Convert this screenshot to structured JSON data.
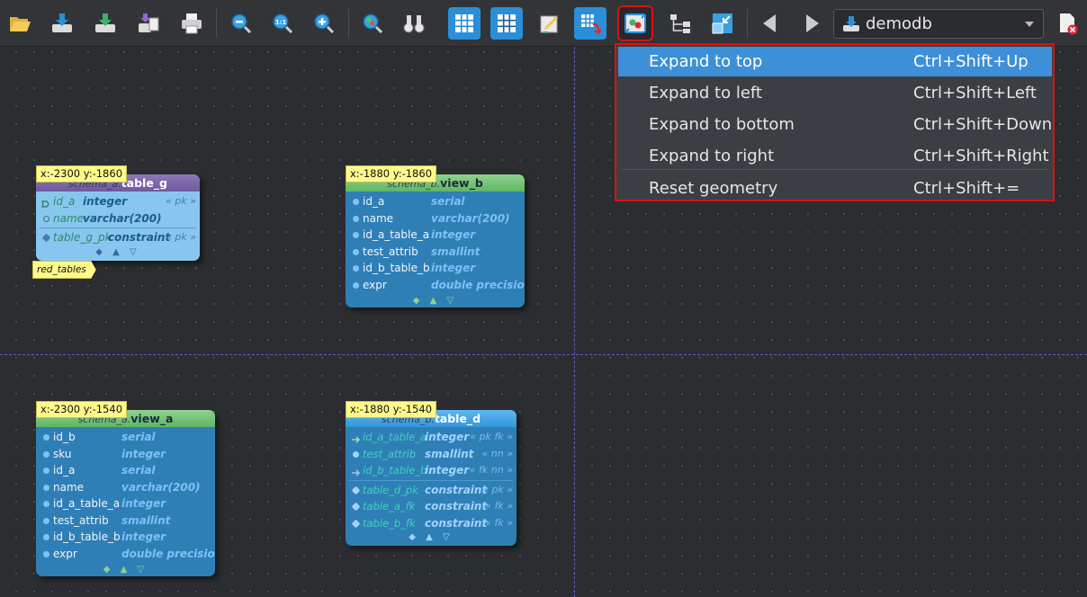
{
  "toolbar": {
    "buttons": [
      {
        "id": "open",
        "icon": "folder-open-icon"
      },
      {
        "id": "save",
        "icon": "save-icon"
      },
      {
        "id": "save-as",
        "icon": "save-as-icon"
      },
      {
        "id": "export",
        "icon": "export-icon"
      },
      {
        "id": "print",
        "icon": "printer-icon"
      },
      {
        "id": "zoom-out",
        "icon": "zoom-out-icon"
      },
      {
        "id": "zoom-reset",
        "icon": "zoom-reset-icon",
        "text": "1:1"
      },
      {
        "id": "zoom-in",
        "icon": "zoom-in-icon"
      },
      {
        "id": "overview",
        "icon": "overview-icon"
      },
      {
        "id": "find",
        "icon": "binoculars-icon"
      },
      {
        "id": "show-grid",
        "icon": "grid-icon"
      },
      {
        "id": "align-grid",
        "icon": "align-grid-icon"
      },
      {
        "id": "edit",
        "icon": "edit-icon"
      },
      {
        "id": "swap",
        "icon": "swap-objects-icon"
      },
      {
        "id": "expand-canvas",
        "icon": "expand-canvas-icon"
      },
      {
        "id": "arrange",
        "icon": "arrange-objects-icon"
      },
      {
        "id": "collapse",
        "icon": "collapse-icon"
      },
      {
        "id": "back",
        "icon": "arrow-left-icon"
      },
      {
        "id": "forward",
        "icon": "arrow-right-icon"
      }
    ],
    "database": "demodb"
  },
  "menu": {
    "items": [
      {
        "label": "Expand to top",
        "shortcut": "Ctrl+Shift+Up"
      },
      {
        "label": "Expand to left",
        "shortcut": "Ctrl+Shift+Left"
      },
      {
        "label": "Expand to bottom",
        "shortcut": "Ctrl+Shift+Down"
      },
      {
        "label": "Expand to right",
        "shortcut": "Ctrl+Shift+Right"
      },
      {
        "label": "Reset geometry",
        "shortcut": "Ctrl+Shift+="
      }
    ]
  },
  "canvas": {
    "table_g": {
      "coord": "x:-2300 y:-1860",
      "schema": "schema_a.",
      "name": "table_g",
      "tag": "red_tables",
      "columns": [
        {
          "name": "id_a",
          "type": "integer",
          "constraint": "« pk »"
        },
        {
          "name": "name",
          "type": "varchar(200)",
          "constraint": ""
        }
      ],
      "constraints": [
        {
          "name": "table_g_pk",
          "type": "constraint",
          "constraint": "« pk »"
        }
      ]
    },
    "view_b": {
      "coord": "x:-1880 y:-1860",
      "schema": "schema_b.",
      "name": "view_b",
      "columns": [
        {
          "name": "id_a",
          "type": "serial"
        },
        {
          "name": "name",
          "type": "varchar(200)"
        },
        {
          "name": "id_a_table_a",
          "type": "integer"
        },
        {
          "name": "test_attrib",
          "type": "smallint"
        },
        {
          "name": "id_b_table_b",
          "type": "integer"
        },
        {
          "name": "expr",
          "type": "double precision"
        }
      ]
    },
    "view_a": {
      "coord": "x:-2300 y:-1540",
      "schema": "schema_a.",
      "name": "view_a",
      "columns": [
        {
          "name": "id_b",
          "type": "serial"
        },
        {
          "name": "sku",
          "type": "integer"
        },
        {
          "name": "id_a",
          "type": "serial"
        },
        {
          "name": "name",
          "type": "varchar(200)"
        },
        {
          "name": "id_a_table_a",
          "type": "integer"
        },
        {
          "name": "test_attrib",
          "type": "smallint"
        },
        {
          "name": "id_b_table_b",
          "type": "integer"
        },
        {
          "name": "expr",
          "type": "double precision"
        }
      ]
    },
    "table_d": {
      "coord": "x:-1880 y:-1540",
      "schema": "schema_b.",
      "name": "table_d",
      "columns": [
        {
          "name": "id_a_table_a",
          "type": "integer",
          "constraint": "« pk fk »"
        },
        {
          "name": "test_attrib",
          "type": "smallint",
          "constraint": "« nn »"
        },
        {
          "name": "id_b_table_b",
          "type": "integer",
          "constraint": "« fk nn »"
        }
      ],
      "constraints": [
        {
          "name": "table_d_pk",
          "type": "constraint",
          "constraint": "« pk »"
        },
        {
          "name": "table_a_fk",
          "type": "constraint",
          "constraint": "« fk »"
        },
        {
          "name": "table_b_fk",
          "type": "constraint",
          "constraint": "« fk »"
        }
      ]
    },
    "extension_marks": "◆ ▲ ▽"
  },
  "colors": {
    "menu_highlight": "#3d8fd8",
    "selection_outline": "#dd1111",
    "view_header": "#6bbd6e",
    "table_header_purple": "#7a66a8",
    "table_header_blue": "#4aa8ea"
  }
}
